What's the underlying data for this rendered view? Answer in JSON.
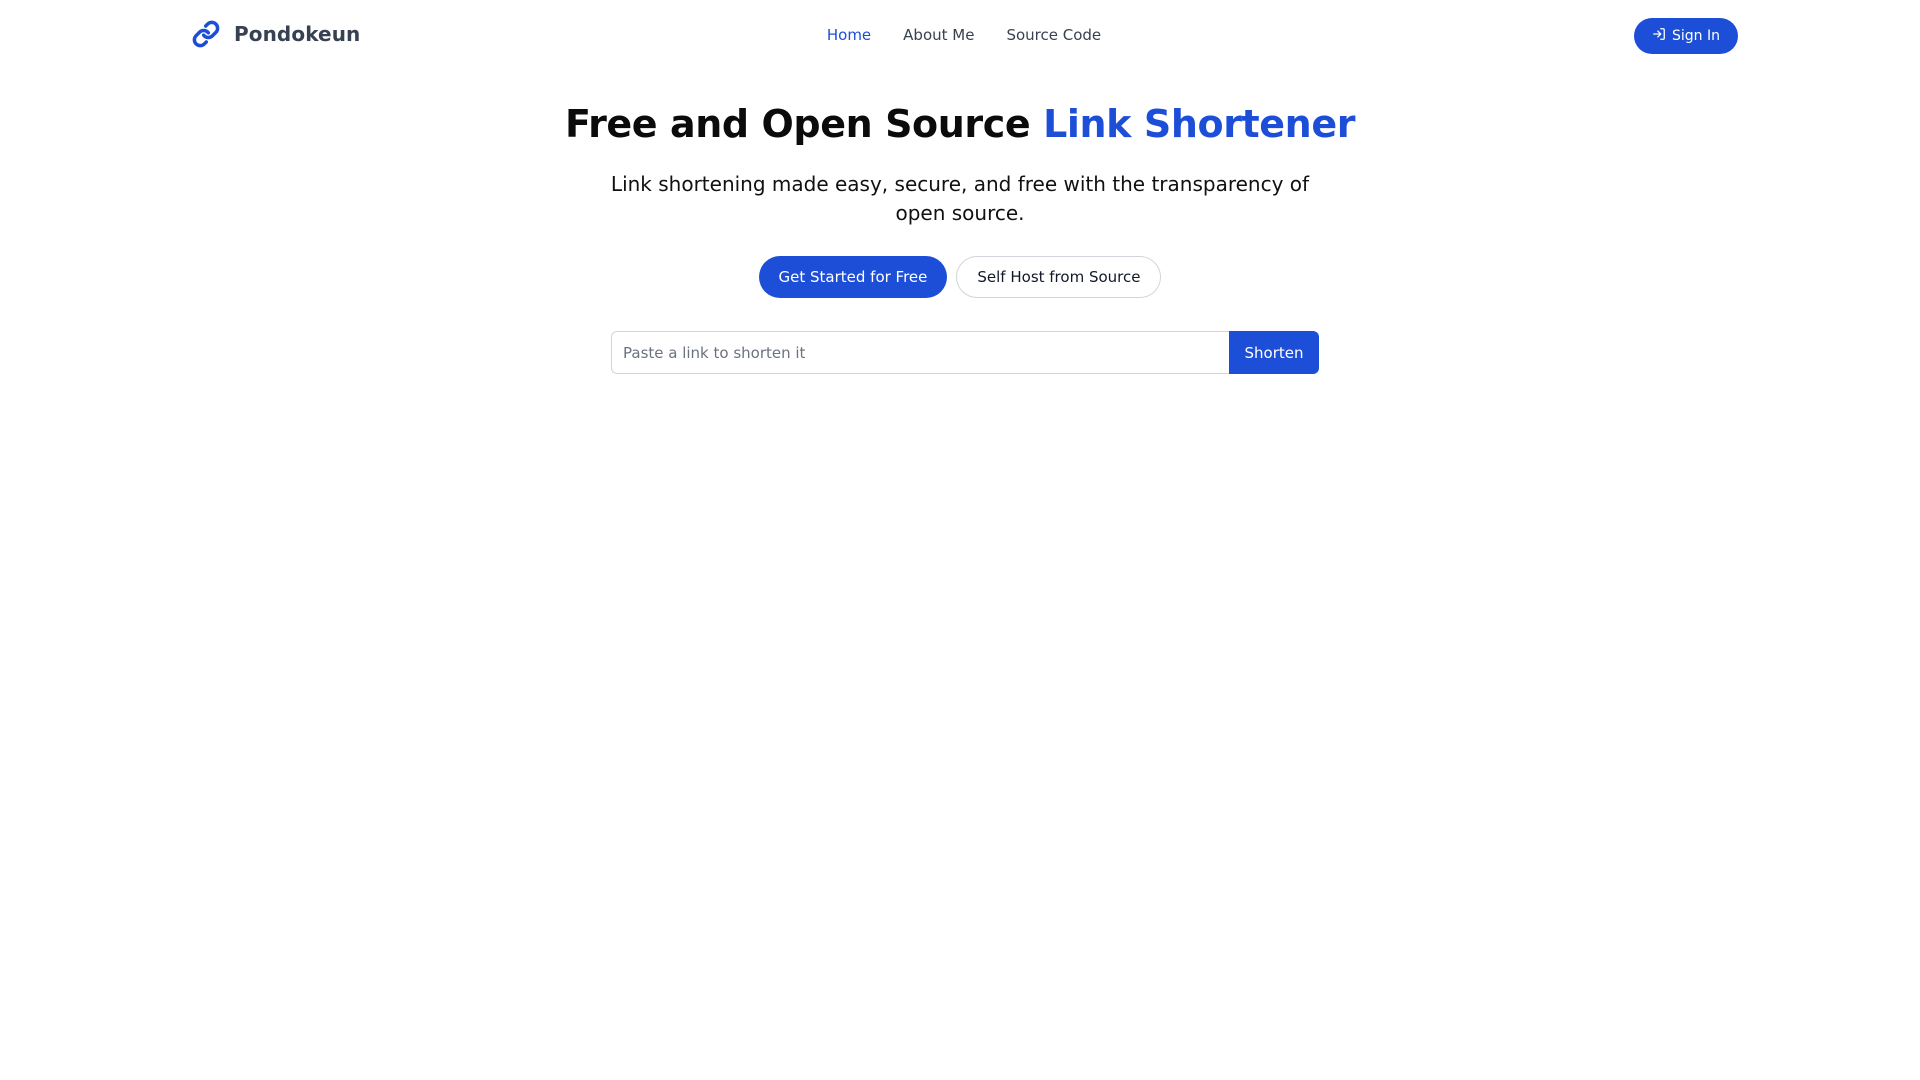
{
  "brand": {
    "name": "Pondokeun",
    "icon": "link-icon",
    "color": "#1d4ed8"
  },
  "nav": {
    "links": [
      {
        "label": "Home",
        "active": true
      },
      {
        "label": "About Me",
        "active": false
      },
      {
        "label": "Source Code",
        "active": false
      }
    ],
    "signin_label": "Sign In",
    "signin_icon": "sign-in-icon"
  },
  "hero": {
    "title_main": "Free and Open Source ",
    "title_accent": "Link Shortener",
    "subtitle": "Link shortening made easy, secure, and free with the transparency of open source.",
    "primary_cta": "Get Started for Free",
    "secondary_cta": "Self Host from Source"
  },
  "shorten": {
    "placeholder": "Paste a link to shorten it",
    "value": "",
    "button_label": "Shorten"
  },
  "colors": {
    "accent": "#1d4ed8",
    "text": "#111827",
    "border": "#d1d5db"
  }
}
